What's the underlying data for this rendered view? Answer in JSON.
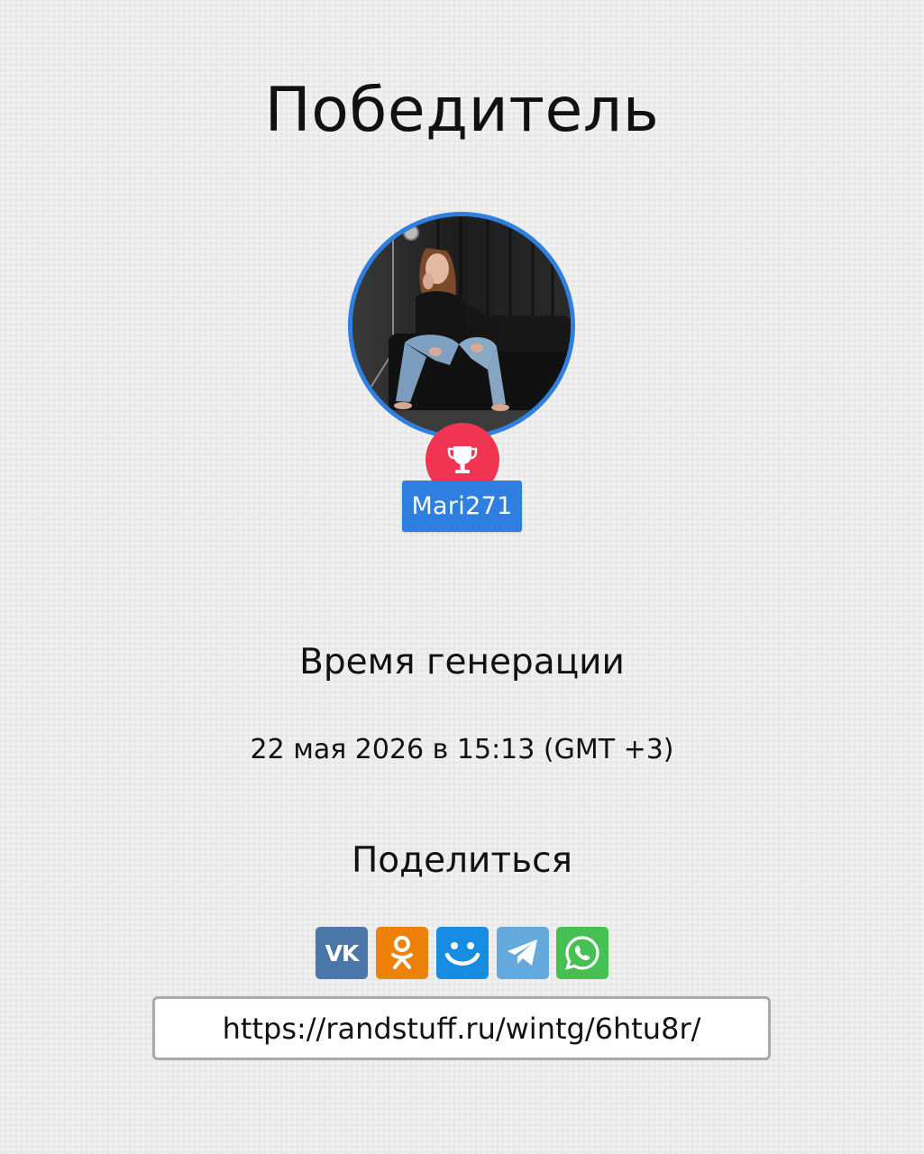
{
  "title": "Победитель",
  "winner": {
    "username": "Mari271",
    "avatar_icon": "profile-photo",
    "badge_icon": "trophy-icon",
    "accent_color": "#2f7fe0",
    "badge_color": "#ef3552"
  },
  "generation": {
    "heading": "Время генерации",
    "time": "22 мая 2026 в 15:13 (GMT +3)"
  },
  "share": {
    "heading": "Поделиться",
    "buttons": [
      {
        "icon": "vk-icon",
        "label": "VK",
        "color": "#4a76a8"
      },
      {
        "icon": "odnoklassniki-icon",
        "color": "#ee8208"
      },
      {
        "icon": "mail-ru-icon",
        "color": "#168de2"
      },
      {
        "icon": "telegram-icon",
        "color": "#64a9dc"
      },
      {
        "icon": "whatsapp-icon",
        "color": "#46c053"
      }
    ],
    "url": "https://randstuff.ru/wintg/6htu8r/"
  }
}
